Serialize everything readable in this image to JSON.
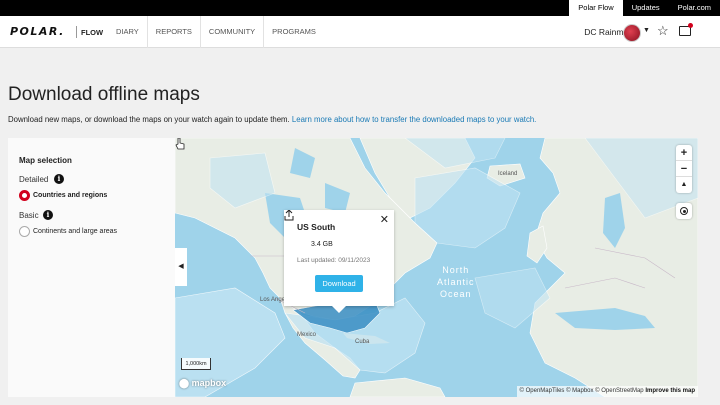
{
  "topbar": {
    "links": [
      "Polar Flow",
      "Updates",
      "Polar.com"
    ]
  },
  "nav": {
    "logo": "POLAR.",
    "flow": "FLOW",
    "items": [
      "DIARY",
      "REPORTS",
      "COMMUNITY",
      "PROGRAMS"
    ],
    "user_name": "DC Rainmaker"
  },
  "page": {
    "title": "Download offline maps",
    "description": "Download new maps, or download the maps on your watch again to update them.",
    "learn_more_link": "Learn more about how to transfer the downloaded maps to your watch."
  },
  "panel": {
    "title": "Map selection",
    "detailed_label": "Detailed",
    "basic_label": "Basic",
    "options": [
      {
        "label": "Countries and regions",
        "checked": true
      },
      {
        "label": "Continents and large areas",
        "checked": false
      }
    ]
  },
  "map": {
    "labels": {
      "iceland": "Iceland",
      "los_angeles": "Los Angeles",
      "mexico": "Mexico",
      "cuba": "Cuba",
      "ocean": "North Atlantic Ocean",
      "ocean_l1": "North",
      "ocean_l2": "Atlantic",
      "ocean_l3": "Ocean"
    },
    "scale": "1,000km",
    "brand": "mapbox",
    "attribution": "© OpenMapTiles © Mapbox © OpenStreetMap",
    "improve": "Improve this map",
    "collapse_glyph": "◀"
  },
  "popup": {
    "title": "US South",
    "size": "3.4 GB",
    "updated": "Last updated: 09/11/2023",
    "button": "Download",
    "close": "✕"
  },
  "colors": {
    "accent": "#d1001c",
    "button": "#2fb2e8",
    "link": "#1a7ab5",
    "ocean": "#9fd3ea",
    "land": "#e8ede5",
    "region": "#bfe3f3",
    "selected_region": "#3b8fc4"
  },
  "icons": {
    "star": "☆",
    "zoom_in": "+",
    "zoom_out": "−",
    "compass": "▲"
  }
}
